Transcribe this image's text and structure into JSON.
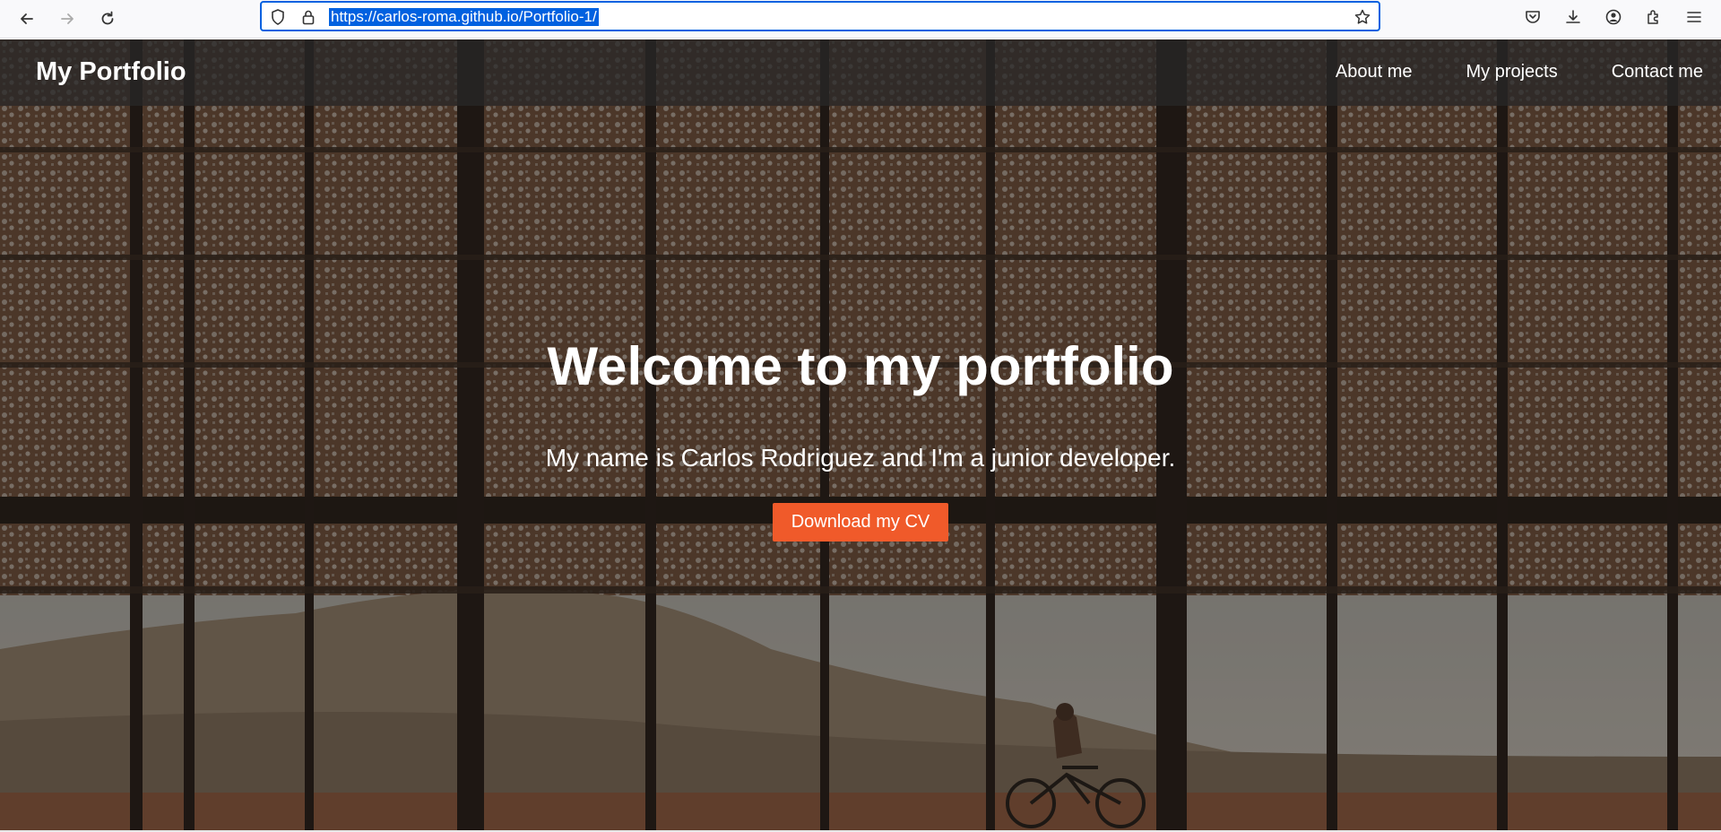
{
  "browser": {
    "url": "https://carlos-roma.github.io/Portfolio-1/",
    "icons": [
      "back-icon",
      "forward-icon",
      "reload-icon",
      "shield-icon",
      "lock-icon",
      "bookmark-star-icon",
      "pocket-icon",
      "download-icon",
      "account-icon",
      "extensions-icon",
      "menu-icon"
    ]
  },
  "navbar": {
    "brand": "My Portfolio",
    "links": [
      {
        "label": "About me"
      },
      {
        "label": "My projects"
      },
      {
        "label": "Contact me"
      }
    ]
  },
  "hero": {
    "title": "Welcome to my portfolio",
    "subtitle": "My name is Carlos Rodriguez and I'm a junior developer.",
    "cta_label": "Download my CV"
  },
  "colors": {
    "accent": "#f05a2a",
    "url_highlight": "#0061e0",
    "navbar_bg": "rgba(40,40,40,0.75)"
  }
}
